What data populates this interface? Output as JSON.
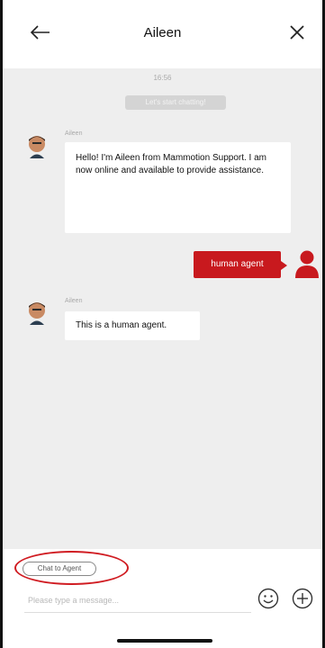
{
  "header": {
    "title": "Aileen",
    "back_icon": "arrow-left-icon",
    "close_icon": "close-icon"
  },
  "chat": {
    "time": "16:56",
    "system_message": "Let's start chatting!",
    "messages": [
      {
        "sender": "Aileen",
        "direction": "incoming",
        "text": "Hello! I'm Aileen from Mammotion Support. I am now online and available to provide assistance."
      },
      {
        "sender": "",
        "direction": "outgoing",
        "text": "human agent"
      },
      {
        "sender": "Aileen",
        "direction": "incoming",
        "text": "This is a human agent."
      }
    ]
  },
  "composer": {
    "chat_to_agent_label": "Chat to Agent",
    "placeholder": "Please type a message...",
    "value": "",
    "emoji_icon": "smiley-icon",
    "add_icon": "plus-circle-icon"
  },
  "colors": {
    "accent": "#c8191e",
    "chat_background": "#eeeeee",
    "highlight": "#d01c22"
  }
}
